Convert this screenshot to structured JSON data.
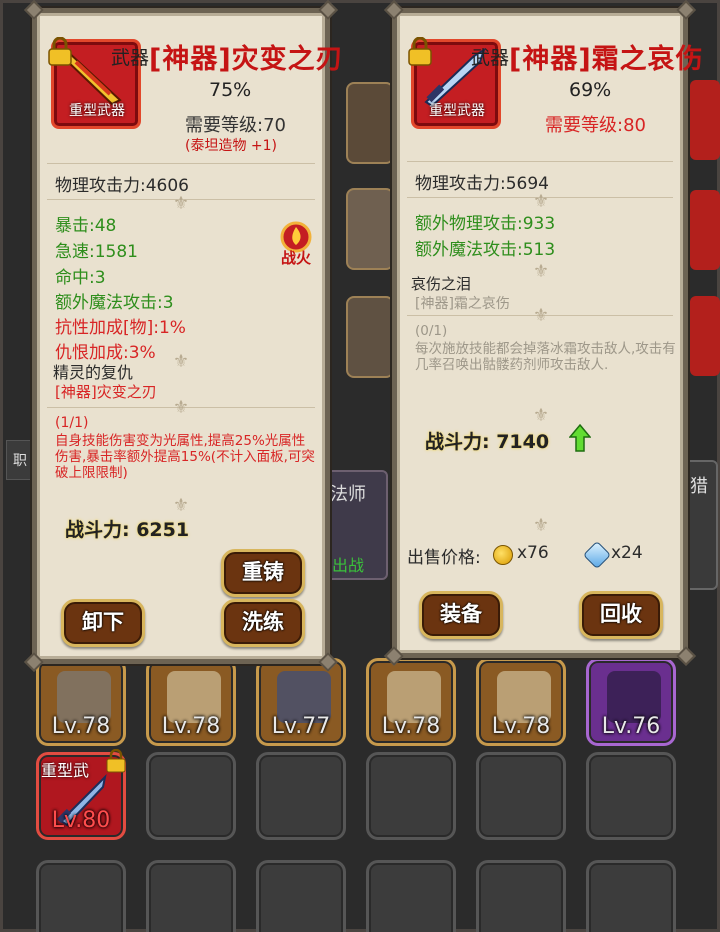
{
  "background": {
    "inventory_row1_levels": [
      "Lv.78",
      "Lv.78",
      "Lv.77",
      "Lv.78",
      "Lv.78",
      "Lv.76"
    ],
    "inventory_row2": {
      "item_label": "重型武",
      "level": "Lv.80"
    },
    "peek_texts": {
      "left_tab": "职",
      "mid_label": "法师",
      "mid_btn": "出战",
      "right_label": "猎"
    }
  },
  "left_panel": {
    "type": "武器",
    "name": "[神器]灾变之刃",
    "icon_label": "重型武器",
    "percent": "75%",
    "required_level": "需要等级:70",
    "note": "(泰坦造物 +1)",
    "main_stat": "物理攻击力:4606",
    "bonus_stats": [
      "暴击:48",
      "急速:1581",
      "命中:3",
      "额外魔法攻击:3"
    ],
    "red_stats": [
      "抗性加成[物]:1%",
      "仇恨加成:3%"
    ],
    "badge_text": "战火",
    "set_name": "精灵的复仇",
    "set_item": "[神器]灾变之刃",
    "set_count": "(1/1)",
    "set_desc": "自身技能伤害变为光属性,提高25%光属性伤害,暴击率额外提高15%(不计入面板,可突破上限限制)",
    "power": "战斗力: 6251",
    "buttons": {
      "recast": "重铸",
      "unequip": "卸下",
      "refine": "洗练"
    }
  },
  "right_panel": {
    "type": "武器",
    "name": "[神器]霜之哀伤",
    "icon_label": "重型武器",
    "percent": "69%",
    "required_level": "需要等级:80",
    "main_stat": "物理攻击力:5694",
    "bonus_stats": [
      "额外物理攻击:933",
      "额外魔法攻击:513"
    ],
    "set_name": "哀伤之泪",
    "set_item": "[神器]霜之哀伤",
    "set_count": "(0/1)",
    "set_desc": "每次施放技能都会掉落冰霜攻击敌人,攻击有几率召唤出骷髅药剂师攻击敌人.",
    "power": "战斗力: 7140",
    "sell_label": "出售价格:",
    "sell_gold": "x76",
    "sell_gem": "x24",
    "buttons": {
      "equip": "装备",
      "recycle": "回收"
    }
  },
  "colors": {
    "panel_bg": "#e9e1cf",
    "item_name": "#c51414",
    "green_stat": "#2e8e1c",
    "red_stat": "#d82525"
  }
}
